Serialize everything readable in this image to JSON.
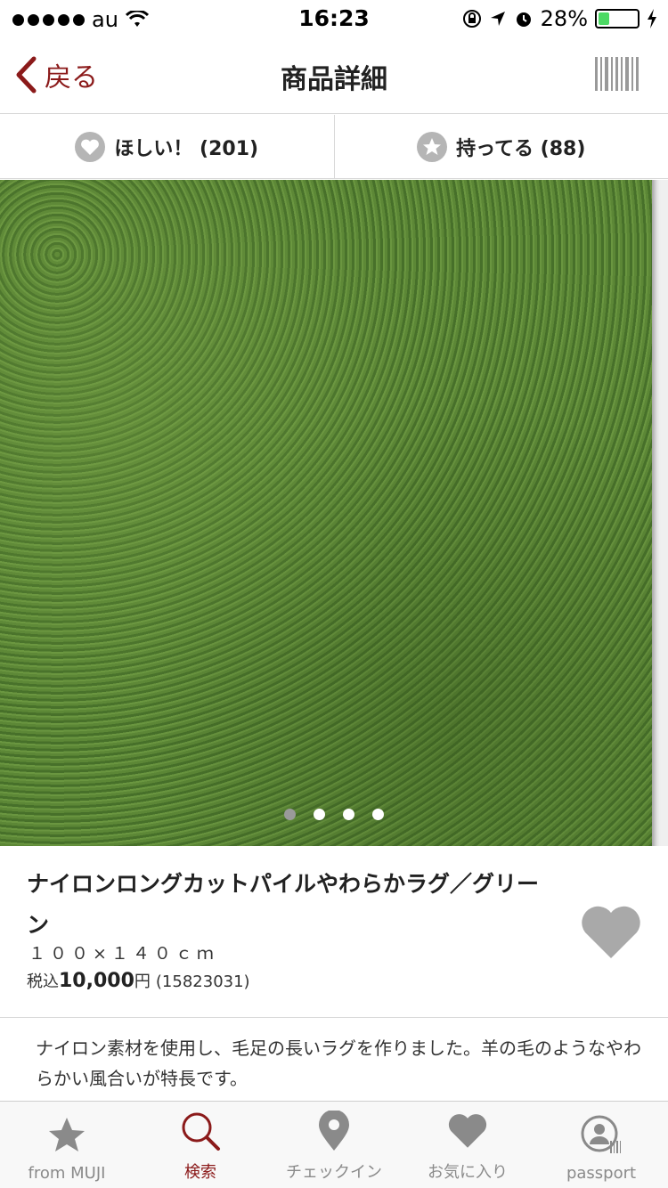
{
  "status_bar": {
    "carrier": "au",
    "time": "16:23",
    "battery_percent": "28%",
    "battery_level": 0.28
  },
  "nav": {
    "back_label": "戻る",
    "title": "商品詳細"
  },
  "actions": {
    "want_label": "ほしい！ (201)",
    "have_label": "持ってる (88)"
  },
  "gallery": {
    "page_count": 4,
    "active_index": 0
  },
  "product": {
    "name": "ナイロンロングカットパイルやわらかラグ／グリーン",
    "size": "１００×１４０ｃｍ",
    "tax_label": "税込",
    "price": "10,000",
    "currency": "円",
    "code": "(15823031)",
    "description": "ナイロン素材を使用し、毛足の長いラグを作りました。羊の毛のようなやわらかい風合いが特長です。"
  },
  "tabs": [
    {
      "label": "from MUJI",
      "icon": "star-icon",
      "active": false
    },
    {
      "label": "検索",
      "icon": "search-icon",
      "active": true
    },
    {
      "label": "チェックイン",
      "icon": "location-pin-icon",
      "active": false
    },
    {
      "label": "お気に入り",
      "icon": "heart-icon",
      "active": false
    },
    {
      "label": "passport",
      "icon": "passport-icon",
      "active": false
    }
  ],
  "colors": {
    "accent": "#8b1a1a",
    "inactive": "#8a8a8a"
  }
}
